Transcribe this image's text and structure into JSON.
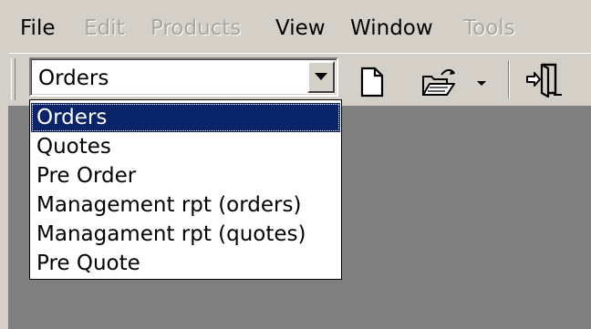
{
  "menu": {
    "items": [
      {
        "label": "File",
        "enabled": true
      },
      {
        "label": "Edit",
        "enabled": false
      },
      {
        "label": "Products",
        "enabled": false
      },
      {
        "label": "View",
        "enabled": true
      },
      {
        "label": "Window",
        "enabled": true
      },
      {
        "label": "Tools",
        "enabled": false
      }
    ]
  },
  "toolbar": {
    "combo": {
      "value": "Orders",
      "options": [
        "Orders",
        "Quotes",
        "Pre Order",
        "Management rpt (orders)",
        "Managament rpt (quotes)",
        "Pre Quote"
      ],
      "selected_index": 0
    },
    "buttons": [
      {
        "icon": "new-document-icon"
      },
      {
        "icon": "open-folder-icon"
      },
      {
        "icon": "dropdown-arrow-icon"
      },
      {
        "icon": "exit-door-icon"
      }
    ]
  },
  "colors": {
    "chrome": "#d4d0c8",
    "client_area": "#808080",
    "selection": "#0a246a",
    "disabled_text": "#a9a6a0"
  }
}
